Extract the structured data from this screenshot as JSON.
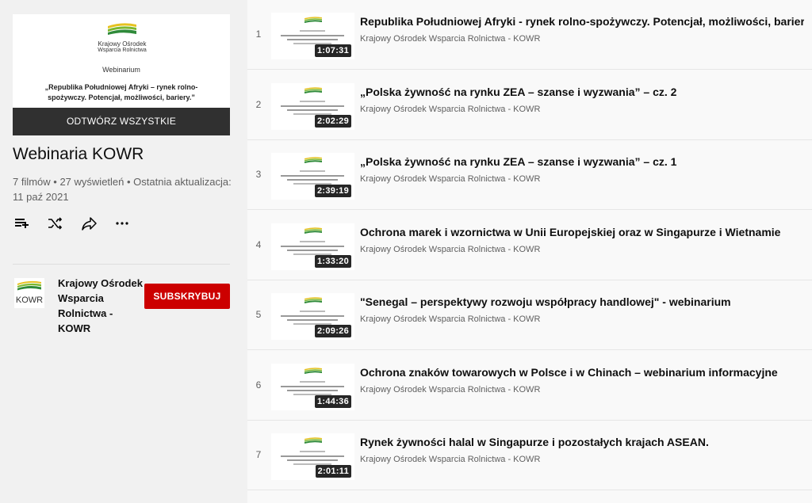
{
  "colors": {
    "brand_red": "#cc0000",
    "logo_green": "#4a9a2a",
    "logo_yellow": "#e6c21f"
  },
  "hero": {
    "logo_line1": "Krajowy Ośrodek",
    "logo_line2": "Wsparcia Rolnictwa",
    "label": "Webinarium",
    "description": "„Republika Południowej Afryki – rynek rolno-spożywczy. Potencjał, możliwości, bariery.”",
    "play_all": "ODTWÓRZ WSZYSTKIE"
  },
  "playlist": {
    "title": "Webinaria KOWR",
    "meta": "7 filmów • 27 wyświetleń • Ostatnia aktualizacja: 11 paź 2021",
    "actions": [
      "add-to-queue-icon",
      "shuffle-icon",
      "share-icon",
      "more-icon"
    ]
  },
  "owner": {
    "avatar_text": "KOWR",
    "name": "Krajowy Ośrodek Wsparcia Rolnictwa - KOWR",
    "subscribe": "SUBSKRYBUJ"
  },
  "videos": [
    {
      "index": "1",
      "title": "Republika Południowej Afryki - rynek rolno-spożywczy. Potencjał, możliwości, bariery.",
      "channel": "Krajowy Ośrodek Wsparcia Rolnictwa - KOWR",
      "duration": "1:07:31"
    },
    {
      "index": "2",
      "title": "„Polska żywność na rynku ZEA – szanse i wyzwania” – cz. 2",
      "channel": "Krajowy Ośrodek Wsparcia Rolnictwa - KOWR",
      "duration": "2:02:29"
    },
    {
      "index": "3",
      "title": "„Polska żywność na rynku ZEA – szanse i wyzwania” – cz. 1",
      "channel": "Krajowy Ośrodek Wsparcia Rolnictwa - KOWR",
      "duration": "2:39:19"
    },
    {
      "index": "4",
      "title": "Ochrona marek i wzornictwa w Unii Europejskiej oraz w Singapurze i Wietnamie",
      "channel": "Krajowy Ośrodek Wsparcia Rolnictwa - KOWR",
      "duration": "1:33:20"
    },
    {
      "index": "5",
      "title": "\"Senegal – perspektywy rozwoju współpracy handlowej\" - webinarium",
      "channel": "Krajowy Ośrodek Wsparcia Rolnictwa - KOWR",
      "duration": "2:09:26"
    },
    {
      "index": "6",
      "title": "Ochrona znaków towarowych w Polsce i w Chinach – webinarium informacyjne",
      "channel": "Krajowy Ośrodek Wsparcia Rolnictwa - KOWR",
      "duration": "1:44:36"
    },
    {
      "index": "7",
      "title": "Rynek żywności halal w Singapurze i pozostałych krajach ASEAN.",
      "channel": "Krajowy Ośrodek Wsparcia Rolnictwa - KOWR",
      "duration": "2:01:11"
    }
  ]
}
